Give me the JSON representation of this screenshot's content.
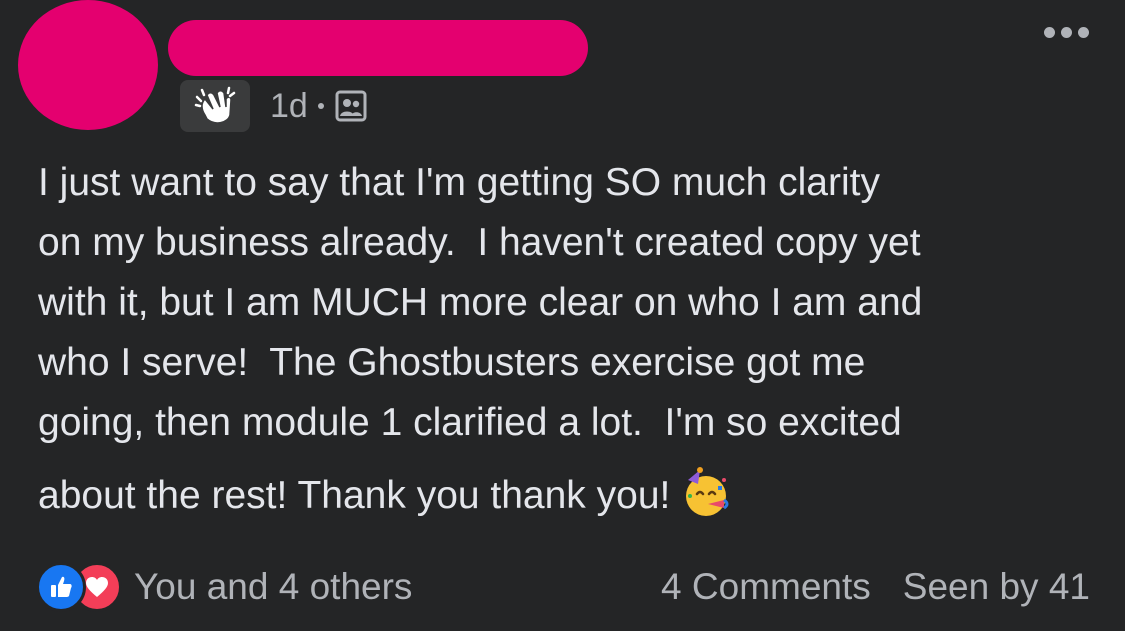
{
  "post": {
    "timestamp": "1d",
    "text_lines": [
      "I just want to say that I'm getting SO much clarity",
      "on my business already.  I haven't created copy yet",
      "with it, but I am MUCH more clear on who I am and",
      "who I serve!  The Ghostbusters exercise got me",
      "going, then module 1 clarified a lot.  I'm so excited",
      "about the rest! Thank you thank you!"
    ],
    "badge_icon": "waving-hand-icon",
    "audience_icon": "group-audience-icon",
    "emoji_icon": "partying-face-emoji"
  },
  "footer": {
    "reactions_text": "You and 4 others",
    "comments_text": "4 Comments",
    "seen_text": "Seen by 41"
  },
  "colors": {
    "background": "#242526",
    "text": "#e4e6eb",
    "secondary_text": "#b0b3b8",
    "redaction": "#e4006f",
    "like_blue": "#1877f2",
    "love_red": "#f33e58"
  }
}
